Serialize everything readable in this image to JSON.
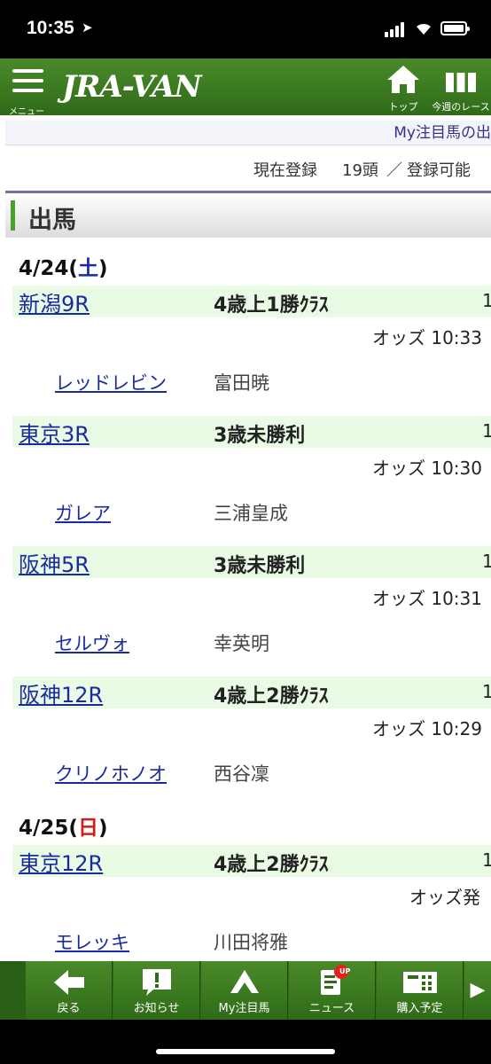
{
  "status": {
    "time": "10:35",
    "location_glyph": "➤"
  },
  "header": {
    "menu_label": "メニュー",
    "logo": "JRA-VAN",
    "top_label": "トップ",
    "week_label": "今週のレース"
  },
  "marquee": "My注目馬の出",
  "registration": {
    "label": "現在登録",
    "count": "19頭",
    "separator": "／",
    "available": "登録可能"
  },
  "section_title": "出馬",
  "days": [
    {
      "date": "4/24(",
      "weekday": "土",
      "close": ")",
      "weekday_color": "#1a2aa0"
    },
    {
      "date": "4/25(",
      "weekday": "日",
      "close": ")",
      "weekday_color": "#d21c1c"
    }
  ],
  "races": [
    {
      "name": "新潟9R",
      "class": "4歳上1勝ｸﾗｽ",
      "num": "1",
      "odds": "オッズ 10:33",
      "horse": "レッドレビン",
      "jockey": "富田暁"
    },
    {
      "name": "東京3R",
      "class": "3歳未勝利",
      "num": "1",
      "odds": "オッズ 10:30",
      "horse": "ガレア",
      "jockey": "三浦皇成"
    },
    {
      "name": "阪神5R",
      "class": "3歳未勝利",
      "num": "1",
      "odds": "オッズ 10:31",
      "horse": "セルヴォ",
      "jockey": "幸英明"
    },
    {
      "name": "阪神12R",
      "class": "4歳上2勝ｸﾗｽ",
      "num": "1",
      "odds": "オッズ 10:29",
      "horse": "クリノホノオ",
      "jockey": "西谷凜"
    },
    {
      "name": "東京12R",
      "class": "4歳上2勝ｸﾗｽ",
      "num": "1",
      "odds": "オッズ発",
      "horse": "モレッキ",
      "jockey": "川田将雅"
    }
  ],
  "footer": {
    "back": "戻る",
    "notice": "お知らせ",
    "my_horses": "My注目馬",
    "news": "ニュース",
    "news_badge": "UP",
    "purchase": "購入予定"
  }
}
